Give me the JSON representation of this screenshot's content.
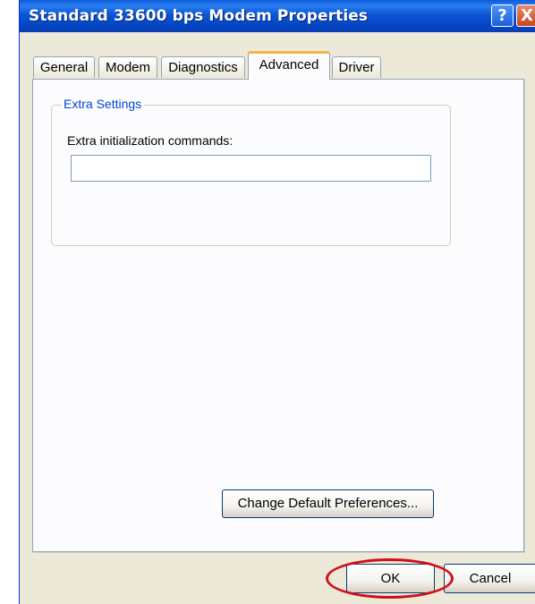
{
  "window": {
    "title": "Standard 33600 bps Modem Properties",
    "help_glyph": "?",
    "close_glyph": "X"
  },
  "tabs": [
    {
      "label": "General"
    },
    {
      "label": "Modem"
    },
    {
      "label": "Diagnostics"
    },
    {
      "label": "Advanced",
      "active": true
    },
    {
      "label": "Driver"
    }
  ],
  "advanced": {
    "group_title": "Extra Settings",
    "extra_init_label": "Extra initialization commands:",
    "extra_init_value": "",
    "change_prefs_label": "Change Default Preferences..."
  },
  "footer": {
    "ok_label": "OK",
    "cancel_label": "Cancel"
  },
  "annotation": {
    "highlight_color": "#d10f1b",
    "highlight_target": "ok-button"
  }
}
